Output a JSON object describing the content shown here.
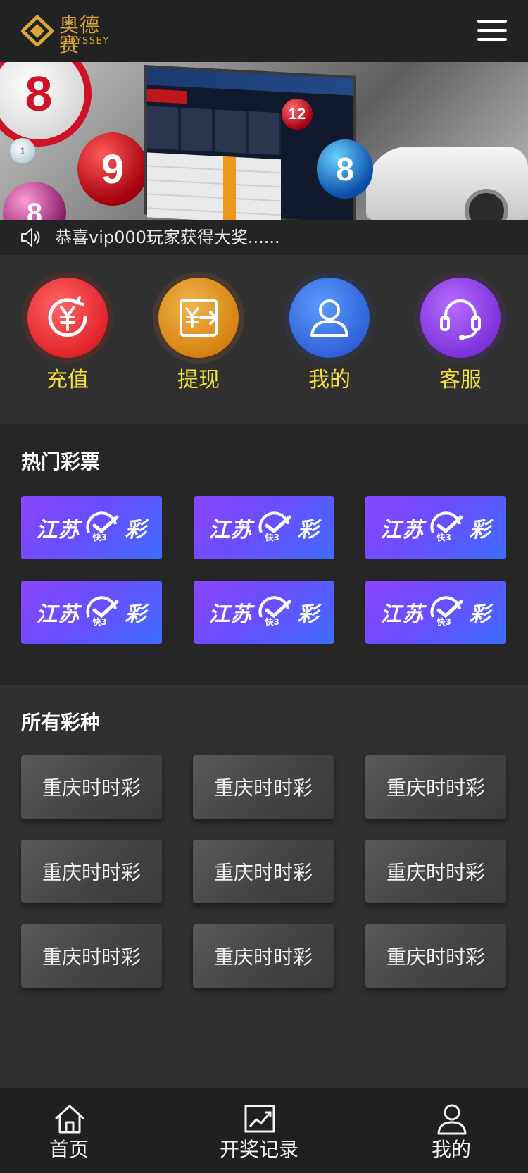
{
  "header": {
    "logo_cn": "奥德赛",
    "logo_en": "ODYSSEY",
    "menu_icon": "hamburger-menu-icon"
  },
  "banner": {
    "ball_numbers": [
      "9",
      "8",
      "8",
      "12",
      "1"
    ],
    "slides": 4,
    "active_slide": 1
  },
  "notice": {
    "icon": "speaker-icon",
    "text": "恭喜vip000玩家获得大奖......"
  },
  "quick_actions": [
    {
      "label": "充值",
      "icon": "yuan-coin-icon",
      "color": "#e63233"
    },
    {
      "label": "提现",
      "icon": "withdraw-yuan-icon",
      "color": "#e09527"
    },
    {
      "label": "我的",
      "icon": "user-icon",
      "color": "#3a72e6"
    },
    {
      "label": "客服",
      "icon": "headset-icon",
      "color": "#8b3fe6"
    }
  ],
  "hot_section": {
    "title": "热门彩票",
    "cards": [
      {
        "name": "江苏",
        "suffix": "彩",
        "badge": "快3"
      },
      {
        "name": "江苏",
        "suffix": "彩",
        "badge": "快3"
      },
      {
        "name": "江苏",
        "suffix": "彩",
        "badge": "快3"
      },
      {
        "name": "江苏",
        "suffix": "彩",
        "badge": "快3"
      },
      {
        "name": "江苏",
        "suffix": "彩",
        "badge": "快3"
      },
      {
        "name": "江苏",
        "suffix": "彩",
        "badge": "快3"
      }
    ]
  },
  "all_section": {
    "title": "所有彩种",
    "items": [
      "重庆时时彩",
      "重庆时时彩",
      "重庆时时彩",
      "重庆时时彩",
      "重庆时时彩",
      "重庆时时彩",
      "重庆时时彩",
      "重庆时时彩",
      "重庆时时彩"
    ]
  },
  "bottom_nav": [
    {
      "label": "首页",
      "icon": "home-icon"
    },
    {
      "label": "开奖记录",
      "icon": "chart-icon"
    },
    {
      "label": "我的",
      "icon": "user-icon"
    }
  ],
  "colors": {
    "accent_gold": "#d9a636",
    "quick_label": "#f1e13c",
    "background": "#2f2f2f"
  }
}
